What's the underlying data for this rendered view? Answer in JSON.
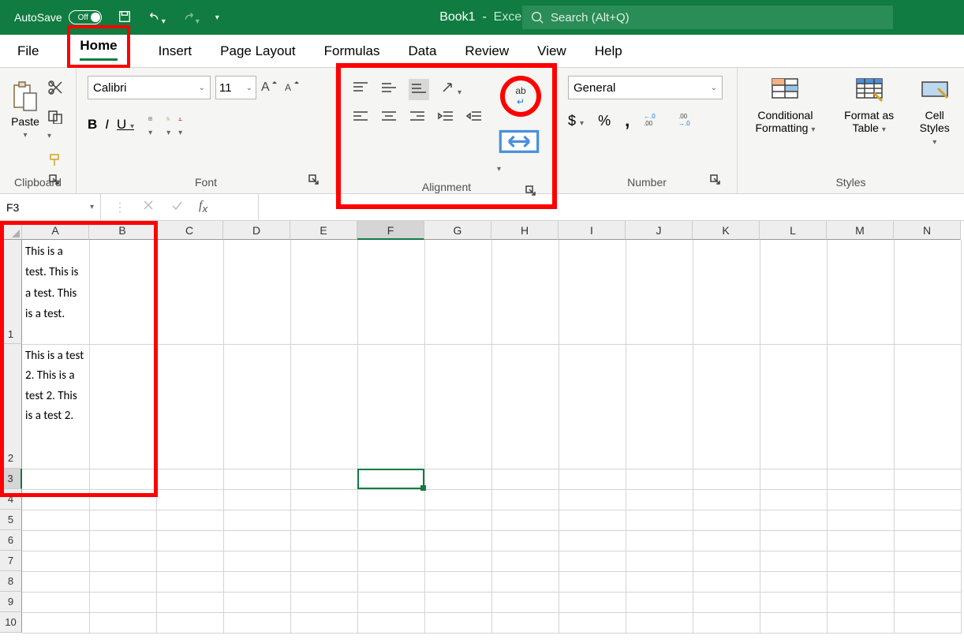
{
  "titlebar": {
    "autosave_label": "AutoSave",
    "autosave_state": "Off",
    "book_name": "Book1",
    "app_name": "Excel",
    "search_placeholder": "Search (Alt+Q)"
  },
  "tabs": {
    "file": "File",
    "home": "Home",
    "insert": "Insert",
    "page_layout": "Page Layout",
    "formulas": "Formulas",
    "data": "Data",
    "review": "Review",
    "view": "View",
    "help": "Help"
  },
  "ribbon": {
    "clipboard": {
      "paste": "Paste",
      "label": "Clipboard"
    },
    "font": {
      "name": "Calibri",
      "size": "11",
      "bold": "B",
      "italic": "I",
      "underline": "U",
      "label": "Font"
    },
    "alignment": {
      "label": "Alignment",
      "wrap": "ab"
    },
    "number": {
      "format": "General",
      "dollar": "$",
      "percent": "%",
      "comma": ",",
      "dec_inc": ".00→.0",
      "label": "Number"
    },
    "styles": {
      "cond": "Conditional Formatting",
      "table": "Format as Table",
      "cell": "Cell Styles",
      "label": "Styles"
    }
  },
  "formula_bar": {
    "name_box": "F3"
  },
  "columns": [
    "A",
    "B",
    "C",
    "D",
    "E",
    "F",
    "G",
    "H",
    "I",
    "J",
    "K",
    "L",
    "M",
    "N"
  ],
  "rows": [
    "1",
    "2",
    "3",
    "4",
    "5",
    "6",
    "7",
    "8",
    "9",
    "10"
  ],
  "cells": {
    "A1": "This is a test. This is a test. This is a test.",
    "A2": "This is a test 2. This is a test 2. This is a test 2."
  },
  "active_cell": "F3"
}
